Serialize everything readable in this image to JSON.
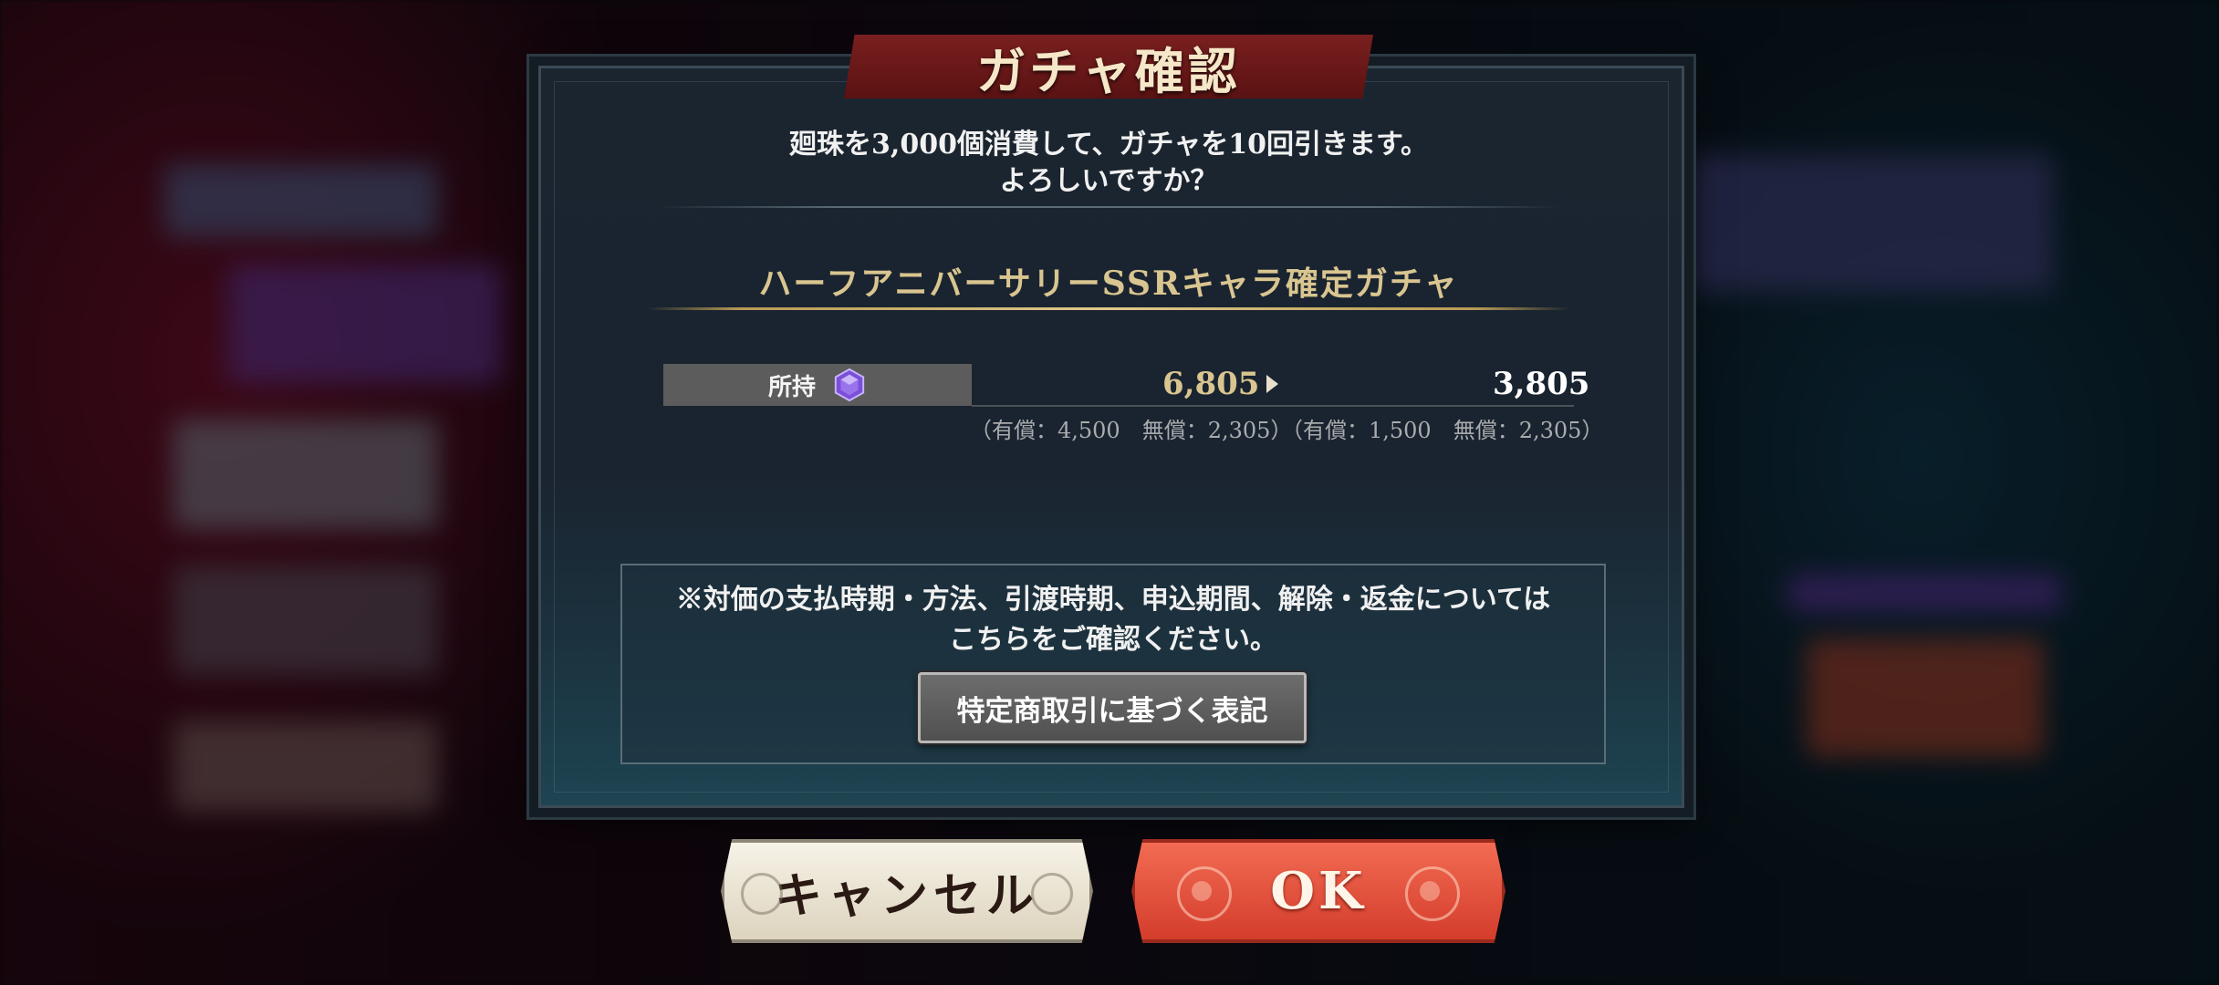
{
  "dialog": {
    "title": "ガチャ確認",
    "message_line1": "廻珠を3,000個消費して、ガチャを10回引きます。",
    "message_line2": "よろしいですか？",
    "gacha_name": "ハーフアニバーサリーSSRキャラ確定ガチャ",
    "owned": {
      "label": "所持",
      "currency_icon": "gem-icon",
      "before": "6,805",
      "after": "3,805",
      "before_breakdown": "（有償：4,500　無償：2,305）",
      "after_breakdown": "（有償：1,500　無償：2,305）"
    },
    "notice_line1": "※対価の支払時期・方法、引渡時期、申込期間、解除・返金については",
    "notice_line2": "こちらをご確認ください。",
    "law_button_label": "特定商取引に基づく表記"
  },
  "buttons": {
    "cancel_label": "キャンセル",
    "ok_label": "OK"
  },
  "colors": {
    "accent_gold": "#d9c590",
    "title_banner": "#7a1f1f",
    "ok_button": "#e2513c",
    "cancel_button": "#ece6d6"
  }
}
